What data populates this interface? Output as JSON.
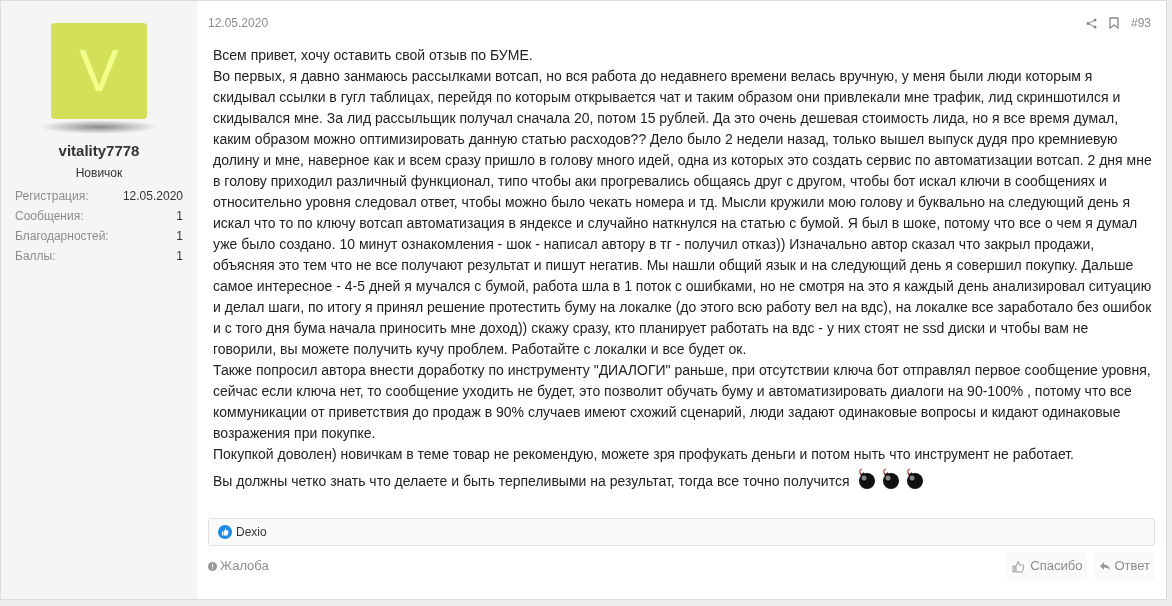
{
  "user": {
    "avatar_letter": "V",
    "name": "vitality7778",
    "title": "Новичок",
    "stats": [
      {
        "label": "Регистрация:",
        "value": "12.05.2020"
      },
      {
        "label": "Сообщения:",
        "value": "1"
      },
      {
        "label": "Благодарностей:",
        "value": "1"
      },
      {
        "label": "Баллы:",
        "value": "1"
      }
    ]
  },
  "post": {
    "date": "12.05.2020",
    "number": "#93",
    "paragraphs": [
      "Всем привет, хочу оставить свой отзыв по БУМЕ.",
      "Во первых, я давно занмаюсь рассылками вотсап, но вся работа до недавнего времени велась вручную, у меня были люди которым я скидывал ссылки в гугл таблицах, перейдя по которым открывается чат и таким образом они привлекали мне трафик, лид скриншотился и скидывался мне. За лид рассыльщик получал сначала 20, потом 15 рублей. Да это очень дешевая стоимость лида, но я все время думал, каким образом можно оптимизировать данную статью расходов?? Дело было 2 недели назад, только вышел выпуск дудя про кремниевую долину и мне, наверное как и всем сразу пришло в голову много идей, одна из которых это создать сервис по автоматизации вотсап. 2 дня мне в голову приходил различный функционал, типо чтобы аки прогревались общаясь друг с другом, чтобы бот искал ключи в сообщениях и относительно уровня следовал ответ, чтобы можно было чекать номера и тд. Мысли кружили мою голову и буквально на следующий день я искал что то по ключу вотсап автоматизация в яндексе и случайно наткнулся на статью с бумой. Я был в шоке, потому что все о чем я думал уже было создано. 10 минут ознакомления - шок - написал автору в тг - получил отказ)) Изначально автор сказал что закрыл продажи, объясняя это тем что не все получают результат и пишут негатив. Мы нашли общий язык и на следующий день я совершил покупку. Дальше самое интересное - 4-5 дней я мучался с бумой, работа шла в 1 поток с ошибками, но не смотря на это я каждый день анализировал ситуацию и делал шаги, по итогу я принял решение протестить буму на локалке (до этого всю работу вел на вдс), на локалке все заработало без ошибок и с того дня бума начала приносить мне доход)) скажу сразу, кто планирует работать на вдс - у них стоят не ssd диски и чтобы вам не говорили, вы можете получить кучу проблем. Работайте с локалки и все будет ок.",
      "Также попросил автора внести доработку по инструменту \"ДИАЛОГИ\" раньше, при отсутствии ключа бот отправлял первое сообщение уровня, сейчас если ключа нет, то сообщение уходить не будет, это позволит обучать буму и автоматизировать диалоги на 90-100% , потому что все коммуникации от приветствия до продаж в 90% случаев имеют схожий сценарий, люди задают одинаковые вопросы и кидают одинаковые возражения при покупке.",
      "Покупкой доволен) новичкам в теме товар не рекомендую, можете зря профукать деньги и потом ныть что инструмент не работает.",
      "Вы должны четко знать что делаете и быть терпеливыми на результат, тогда все точно получится"
    ],
    "likes": [
      "Dexio"
    ],
    "report": "Жалоба",
    "thanks": "Спасибо",
    "reply": "Ответ"
  }
}
